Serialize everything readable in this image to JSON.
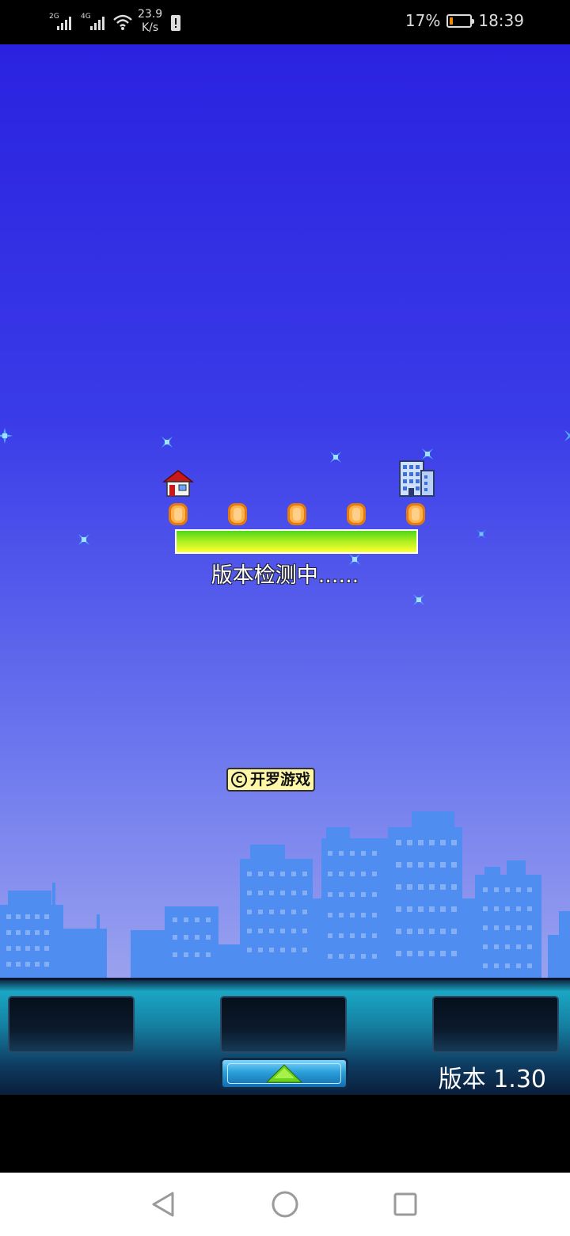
{
  "status_bar": {
    "signal1_label": "2G",
    "signal2_label": "4G",
    "speed_value": "23.9",
    "speed_unit": "K/s",
    "battery_text": "17%",
    "battery_level": 0.17,
    "time": "18:39"
  },
  "game": {
    "loading_text": "版本检测中......",
    "progress": 1.0,
    "copyright_symbol": "C",
    "copyright_text": "开罗游戏",
    "coin_count": 5
  },
  "panel": {
    "version_label": "版本 1.30"
  },
  "colors": {
    "sky_top": "#2a22e0",
    "sky_bottom": "#9aa2ee",
    "skyline": "#4f8df0",
    "progress_start": "#4fd61a",
    "progress_end": "#ffff33",
    "battery_fill": "#f28a00"
  },
  "icons": {
    "house": "house-icon",
    "building": "building-icon",
    "coin": "coin-icon",
    "arrow_up": "up-arrow-icon",
    "back": "back-triangle-icon",
    "home": "home-circle-icon",
    "recents": "recents-square-icon"
  }
}
